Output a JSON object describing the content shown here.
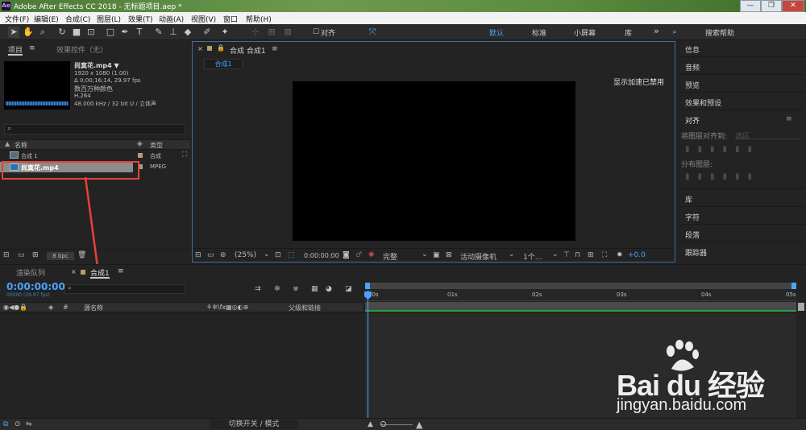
{
  "window": {
    "app_icon": "Ae",
    "title": "Adobe After Effects CC 2018 - 无标题项目.aep *",
    "minimize": "—",
    "maximize": "❐",
    "close": "✕"
  },
  "menu": [
    "文件(F)",
    "编辑(E)",
    "合成(C)",
    "图层(L)",
    "效果(T)",
    "动画(A)",
    "视图(V)",
    "窗口",
    "帮助(H)"
  ],
  "toolbar": {
    "snap_label": "对齐",
    "workspaces": [
      "默认",
      "标准",
      "小屏幕",
      "库"
    ],
    "active_workspace": "默认",
    "more": "»",
    "search_placeholder": "搜索帮助"
  },
  "project_panel": {
    "tab_project": "项目",
    "tab_effects": "效果控件（无）",
    "preview": {
      "name": "尚寞花.mp4 ▼",
      "resolution": "1920 x 1080 (1.00)",
      "duration": "Δ 0;00;16;14, 29.97 fps",
      "colors": "数百万种颜色",
      "codec": "H.264",
      "audio": "48.000 kHz / 32 bit U / 立体声"
    },
    "search_placeholder": "",
    "col_name": "名称",
    "col_type": "类型",
    "items": [
      {
        "name": "合成 1",
        "type": "合成"
      },
      {
        "name": "尚寞花.mp4",
        "type": "MPEG"
      }
    ],
    "bpc": "8 bpc"
  },
  "comp_panel": {
    "tab_label": "合成 合成1",
    "crumb": "合成1",
    "gpu_notice": "显示加速已禁用",
    "zoom": "(25%)",
    "timecode": "0:00:00:00",
    "quality": "完整",
    "camera": "活动摄像机",
    "views": "1个...",
    "exposure": "+0.0"
  },
  "right_panel": {
    "items_top": [
      "信息",
      "音频",
      "预览",
      "效果和预设"
    ],
    "align_title": "对齐",
    "align_to_label": "将图层对齐到:",
    "align_to_value": "选区",
    "distribute_label": "分布图层:",
    "items_bottom": [
      "库",
      "字符",
      "段落",
      "跟踪器"
    ]
  },
  "timeline": {
    "tab_render": "渲染队列",
    "tab_comp": "合成1",
    "timecode": "0:00:00:00",
    "fps": "00000 (29.97 fps)",
    "search_placeholder": "",
    "col_source": "源名称",
    "col_parent": "父级和链接",
    "ticks": [
      "00s",
      "01s",
      "02s",
      "03s",
      "04s",
      "05s"
    ],
    "footer_toggle": "切换开关 / 模式"
  },
  "annotation": {
    "color": "#e8413a"
  },
  "watermark": {
    "brand": "Bai du 经验",
    "url": "jingyan.baidu.com"
  },
  "colors": {
    "accent_blue": "#4aa3ff",
    "highlight_red": "#e8413a",
    "workarea_green": "#2ca03c"
  }
}
